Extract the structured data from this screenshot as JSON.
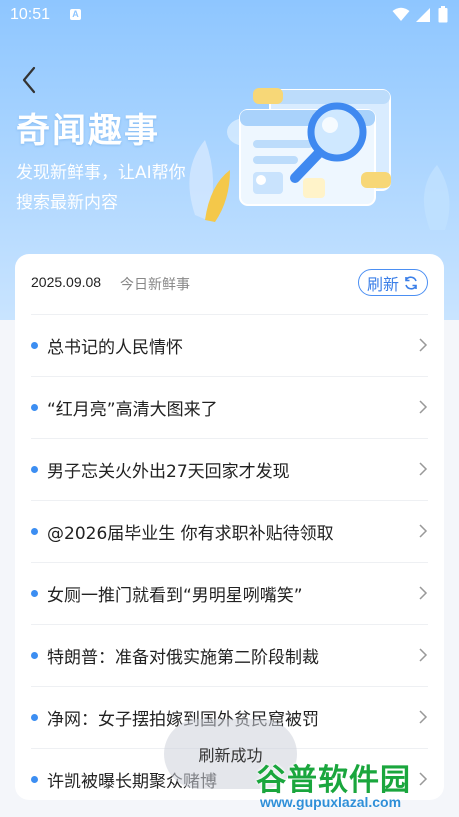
{
  "status_bar": {
    "time": "10:51",
    "notification_icon_label": "A"
  },
  "header": {
    "title": "奇闻趣事",
    "subtitle": "发现新鲜事，让AI帮你搜索最新内容"
  },
  "card": {
    "date": "2025.09.08",
    "daily_label": "今日新鲜事",
    "refresh_label": "刷新"
  },
  "news_items": [
    {
      "title": "总书记的人民情怀"
    },
    {
      "title": "“红月亮”高清大图来了"
    },
    {
      "title": "男子忘关火外出27天回家才发现"
    },
    {
      "title": "@2026届毕业生 你有求职补贴待领取"
    },
    {
      "title": "女厕一推门就看到“男明星咧嘴笑”"
    },
    {
      "title": "特朗普：准备对俄实施第二阶段制裁"
    },
    {
      "title": "净网：女子摆拍嫁到国外贫民窟被罚"
    },
    {
      "title": "许凯被曝长期聚众赌博"
    }
  ],
  "toast": {
    "message": "刷新成功"
  },
  "watermark": {
    "title": "谷普软件园",
    "url": "www.gupuxlazal.com"
  },
  "colors": {
    "accent": "#3c8ef2",
    "hero_top": "#8ec6ff",
    "watermark_green": "#1aa63d"
  },
  "icons": [
    "back-arrow-icon",
    "refresh-icon",
    "chevron-right-icon",
    "wifi-icon",
    "signal-icon",
    "battery-icon"
  ]
}
